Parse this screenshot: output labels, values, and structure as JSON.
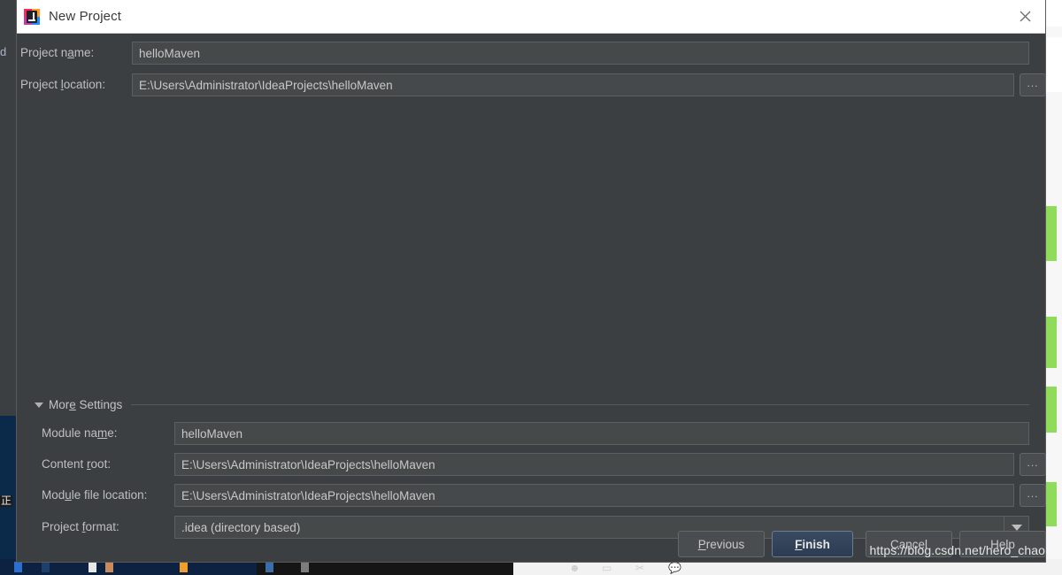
{
  "window": {
    "title": "New Project",
    "app_icon": "intellij-idea-icon",
    "close_icon": "close-icon"
  },
  "form": {
    "project_name": {
      "label_pre": "Project n",
      "label_mnemonic": "a",
      "label_post": "me:",
      "value": "helloMaven"
    },
    "project_location": {
      "label_pre": "Project ",
      "label_mnemonic": "l",
      "label_post": "ocation:",
      "value": "E:\\Users\\Administrator\\IdeaProjects\\helloMaven",
      "browse_label": "..."
    }
  },
  "more_settings": {
    "label_pre": "Mor",
    "label_mnemonic": "e",
    "label_post": " Settings",
    "expanded": true,
    "triangle_icon": "triangle-down-icon",
    "module_name": {
      "label_pre": "Module na",
      "label_mnemonic": "m",
      "label_post": "e:",
      "value": "helloMaven"
    },
    "content_root": {
      "label_pre": "Content ",
      "label_mnemonic": "r",
      "label_post": "oot:",
      "value": "E:\\Users\\Administrator\\IdeaProjects\\helloMaven",
      "browse_label": "..."
    },
    "module_file_location": {
      "label_pre": "Mod",
      "label_mnemonic": "u",
      "label_post": "le file location:",
      "value": "E:\\Users\\Administrator\\IdeaProjects\\helloMaven",
      "browse_label": "..."
    },
    "project_format": {
      "label_pre": "Project ",
      "label_mnemonic": "f",
      "label_post": "ormat:",
      "value": ".idea (directory based)",
      "arrow_icon": "chevron-down-icon"
    }
  },
  "buttons": {
    "previous": {
      "pre": "",
      "mnemonic": "P",
      "post": "revious"
    },
    "finish": {
      "pre": "",
      "mnemonic": "F",
      "post": "inish",
      "is_default": true
    },
    "cancel": {
      "pre": "Cancel",
      "mnemonic": "",
      "post": ""
    },
    "help": {
      "pre": "Help",
      "mnemonic": "",
      "post": ""
    }
  },
  "watermark": "https://blog.csdn.net/hero_chao",
  "background": {
    "left_edge_text": "d",
    "left_edge_glyph": "\\",
    "left_char": "正"
  },
  "colors": {
    "dialog_bg": "#3c3f41",
    "titlebar_bg": "#ffffff",
    "field_bg": "#45494a",
    "accent_default_button": "#394a62",
    "text": "#bfbfbf",
    "marker_green": "#8fdc5a"
  }
}
